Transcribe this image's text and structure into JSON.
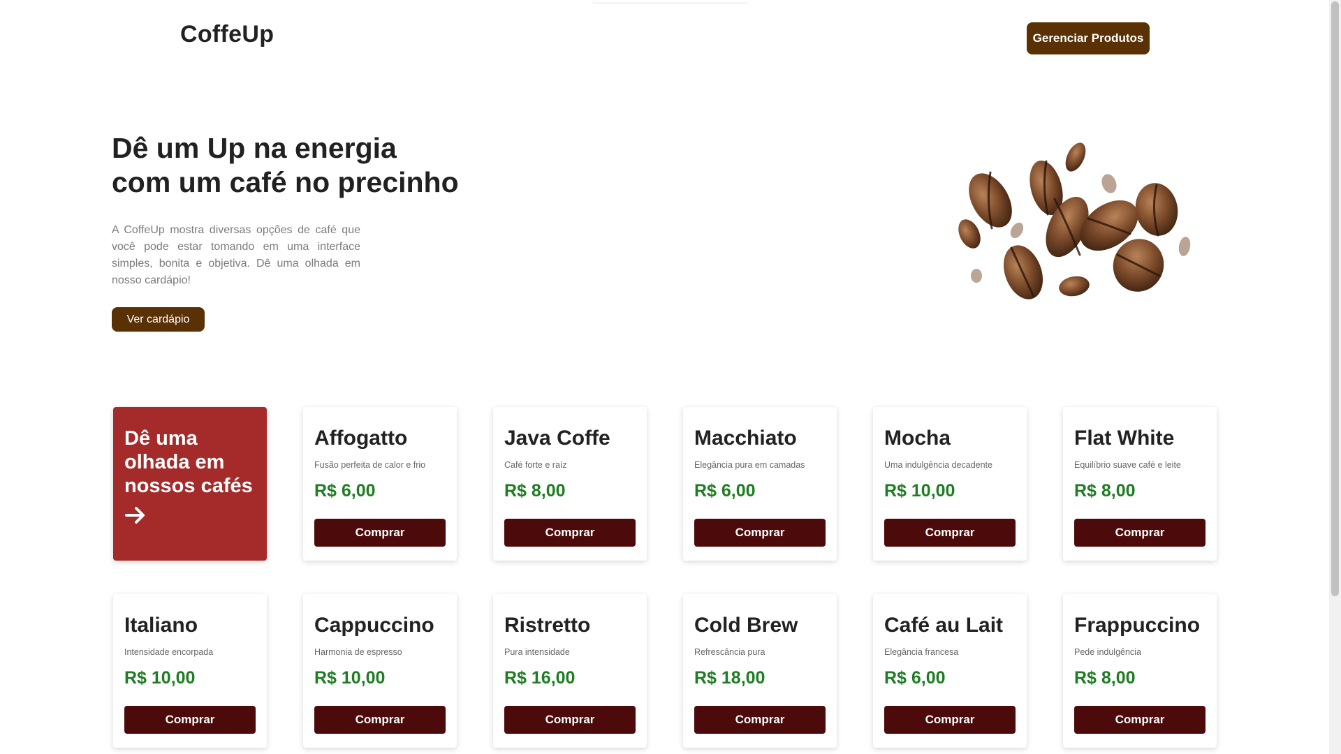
{
  "header": {
    "logo": "CoffeUp",
    "manage_button": "Gerenciar Produtos"
  },
  "hero": {
    "title_line1": "Dê um Up na energia",
    "title_line2": "com um café no precinho",
    "description": "A CoffeUp mostra diversas opções de café que você pode estar tomando em uma interface simples, bonita e objetiva. Dê uma olhada em nosso cardápio!",
    "menu_button": "Ver cardápio",
    "image_icon": "coffee-beans-image"
  },
  "promo": {
    "text": "Dê uma olhada em nossos cafés",
    "icon": "arrow-right-icon"
  },
  "products": [
    {
      "name": "Affogatto",
      "desc": "Fusão perfeita de calor e frio",
      "price": "R$ 6,00",
      "button": "Comprar"
    },
    {
      "name": "Java Coffe",
      "desc": "Café forte e raíz",
      "price": "R$ 8,00",
      "button": "Comprar"
    },
    {
      "name": "Macchiato",
      "desc": "Elegância pura em camadas",
      "price": "R$ 6,00",
      "button": "Comprar"
    },
    {
      "name": "Mocha",
      "desc": "Uma indulgência decadente",
      "price": "R$ 10,00",
      "button": "Comprar"
    },
    {
      "name": "Flat White",
      "desc": "Equilíbrio suave café e leite",
      "price": "R$ 8,00",
      "button": "Comprar"
    },
    {
      "name": "Italiano",
      "desc": "Intensidade encorpada",
      "price": "R$ 10,00",
      "button": "Comprar"
    },
    {
      "name": "Cappuccino",
      "desc": "Harmonia de espresso",
      "price": "R$ 10,00",
      "button": "Comprar"
    },
    {
      "name": "Ristretto",
      "desc": "Pura intensidade",
      "price": "R$ 16,00",
      "button": "Comprar"
    },
    {
      "name": "Cold Brew",
      "desc": "Refrescância pura",
      "price": "R$ 18,00",
      "button": "Comprar"
    },
    {
      "name": "Café au Lait",
      "desc": "Elegância francesa",
      "price": "R$ 6,00",
      "button": "Comprar"
    },
    {
      "name": "Frappuccino",
      "desc": "Pede indulgência",
      "price": "R$ 8,00",
      "button": "Comprar"
    }
  ],
  "colors": {
    "brand_brown": "#5a3105",
    "promo_red": "#a52a2a",
    "buy_button": "#4d0a0a",
    "price_green": "#1e7d22"
  }
}
